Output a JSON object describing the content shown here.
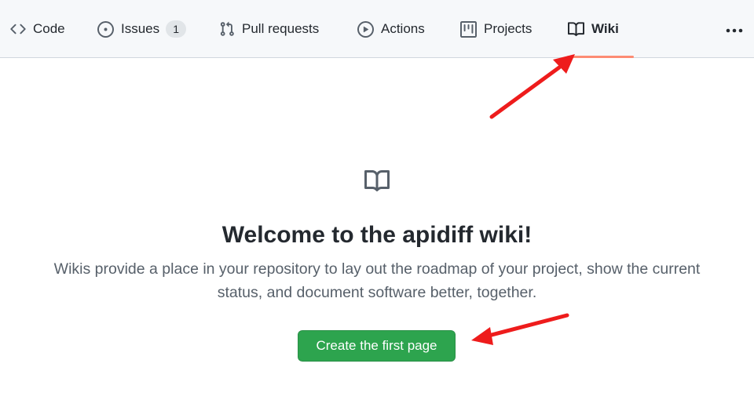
{
  "repo_nav": {
    "tabs": [
      {
        "key": "code",
        "label": "Code",
        "icon": "code-icon"
      },
      {
        "key": "issues",
        "label": "Issues",
        "icon": "issue-opened-icon",
        "counter": "1"
      },
      {
        "key": "pull_requests",
        "label": "Pull requests",
        "icon": "git-pull-request-icon"
      },
      {
        "key": "actions",
        "label": "Actions",
        "icon": "play-icon"
      },
      {
        "key": "projects",
        "label": "Projects",
        "icon": "table-icon"
      },
      {
        "key": "wiki",
        "label": "Wiki",
        "icon": "book-icon",
        "selected": true
      }
    ],
    "more_icon": "kebab-horizontal-icon"
  },
  "blankslate": {
    "icon": "book-icon",
    "title": "Welcome to the apidiff wiki!",
    "description": "Wikis provide a place in your repository to lay out the roadmap of your project, show the current status, and document software better, together.",
    "button_label": "Create the first page"
  },
  "colors": {
    "nav_background": "#f6f8fa",
    "selected_underline": "#fd8c73",
    "primary_button": "#2da44e",
    "annotation_arrow": "#ee1c1c",
    "text_primary": "#24292f",
    "text_muted": "#57606a"
  }
}
